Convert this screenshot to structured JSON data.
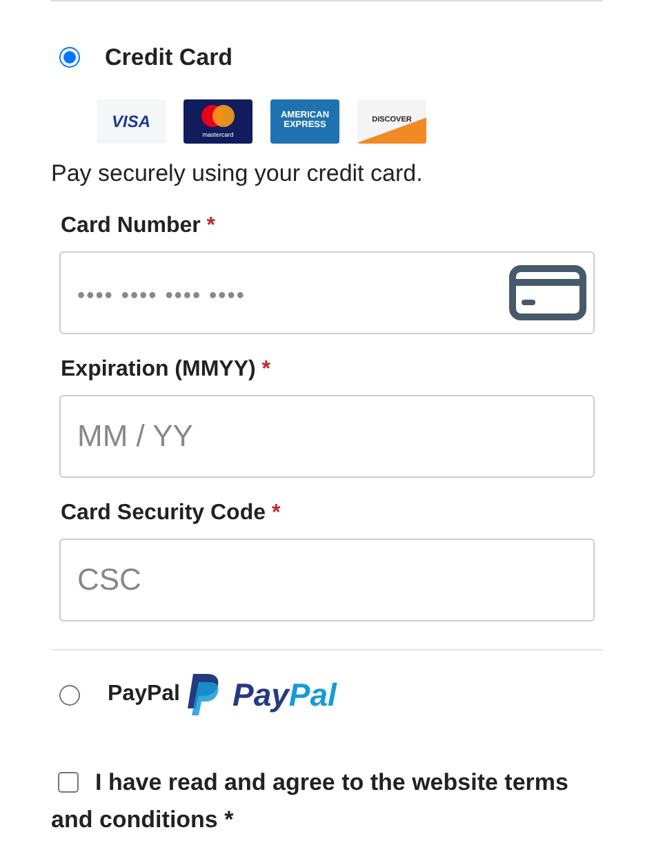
{
  "payment_methods": [
    {
      "kind": "card",
      "label": "Credit Card",
      "selected": true,
      "logos": [
        {
          "kind": "visa",
          "text": "VISA"
        },
        {
          "kind": "mastercard",
          "text": "mastercard"
        },
        {
          "kind": "amex",
          "text": "AMERICAN EXPRESS"
        },
        {
          "kind": "discover",
          "text": "DISCOVER"
        }
      ],
      "description": "Pay securely using your credit card.",
      "fields": [
        {
          "label": "Card Number",
          "required_mark": "*",
          "placeholder": "•••• •••• •••• ••••",
          "kind": "card_number"
        },
        {
          "label": "Expiration (MMYY)",
          "required_mark": "*",
          "placeholder": "MM / YY",
          "kind": "plain"
        },
        {
          "label": "Card Security Code",
          "required_mark": "*",
          "placeholder": "CSC",
          "kind": "plain"
        }
      ]
    },
    {
      "kind": "paypal",
      "label": "PayPal",
      "selected": false,
      "wordmark": [
        "Pay",
        "Pal"
      ]
    }
  ],
  "terms": {
    "label_lines": [
      "I have read and agree to the website terms",
      "and conditions"
    ],
    "required_mark": "*",
    "checked": false
  }
}
